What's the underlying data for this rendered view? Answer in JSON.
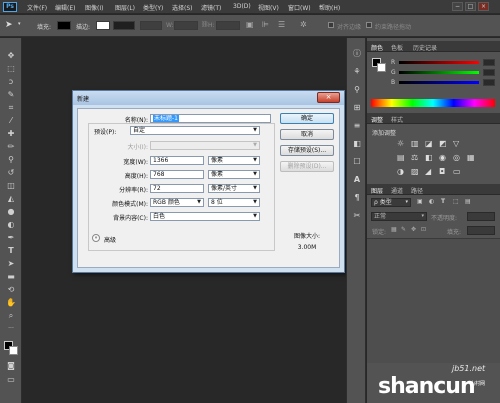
{
  "app": {
    "logo": "Ps"
  },
  "menu": [
    "文件(F)",
    "编辑(E)",
    "图像(I)",
    "图层(L)",
    "类型(Y)",
    "选择(S)",
    "滤镜(T)",
    "3D(D)",
    "视图(V)",
    "窗口(W)",
    "帮助(H)"
  ],
  "window_controls": {
    "minimize": "−",
    "restore": "□",
    "close": "×"
  },
  "options_bar": {
    "fill_label": "填充:",
    "stroke_label": "描边:",
    "w_label": "W:",
    "h_label": "H:",
    "align_edges": "对齐边缘",
    "constrain_path": "约束路径拖动"
  },
  "dialog": {
    "title": "新建",
    "close": "×",
    "name_label": "名称(N):",
    "name_value": "未标题-1",
    "preset_label": "预设(P):",
    "preset_value": "自定",
    "size_label": "大小(I):",
    "size_value": "",
    "width_label": "宽度(W):",
    "width_value": "1366",
    "width_unit": "像素",
    "height_label": "高度(H):",
    "height_value": "768",
    "height_unit": "像素",
    "resolution_label": "分辨率(R):",
    "resolution_value": "72",
    "resolution_unit": "像素/英寸",
    "color_mode_label": "颜色模式(M):",
    "color_mode_value": "RGB 颜色",
    "bit_depth_value": "8 位",
    "background_label": "背景内容(C):",
    "background_value": "白色",
    "advanced_label": "高级",
    "ok": "确定",
    "cancel": "取消",
    "save_preset": "存储预设(S)...",
    "delete_preset": "删除预设(D)...",
    "image_size_label": "图像大小:",
    "image_size_value": "3.00M"
  },
  "right_panel": {
    "color_tabs": [
      "颜色",
      "色板",
      "历史记录"
    ],
    "color_channels": [
      "R",
      "G",
      "B"
    ],
    "adjust_tabs": [
      "调整",
      "样式"
    ],
    "adjust_title": "添加调整",
    "layers_tabs": [
      "图层",
      "通道",
      "路径"
    ],
    "layers_kind": "ρ 类型",
    "blend_mode": "正常",
    "opacity_label": "不透明度:",
    "lock_label": "锁定:",
    "fill_label": "填充:"
  },
  "watermark": {
    "site": "jb51.net",
    "logo": "shancun",
    "sub": "山村网"
  },
  "colors": {
    "accent": "#4ea7e8",
    "dialog_frame": "#cfe0f0",
    "close_red": "#c7402b",
    "selection_blue": "#3399ff"
  }
}
